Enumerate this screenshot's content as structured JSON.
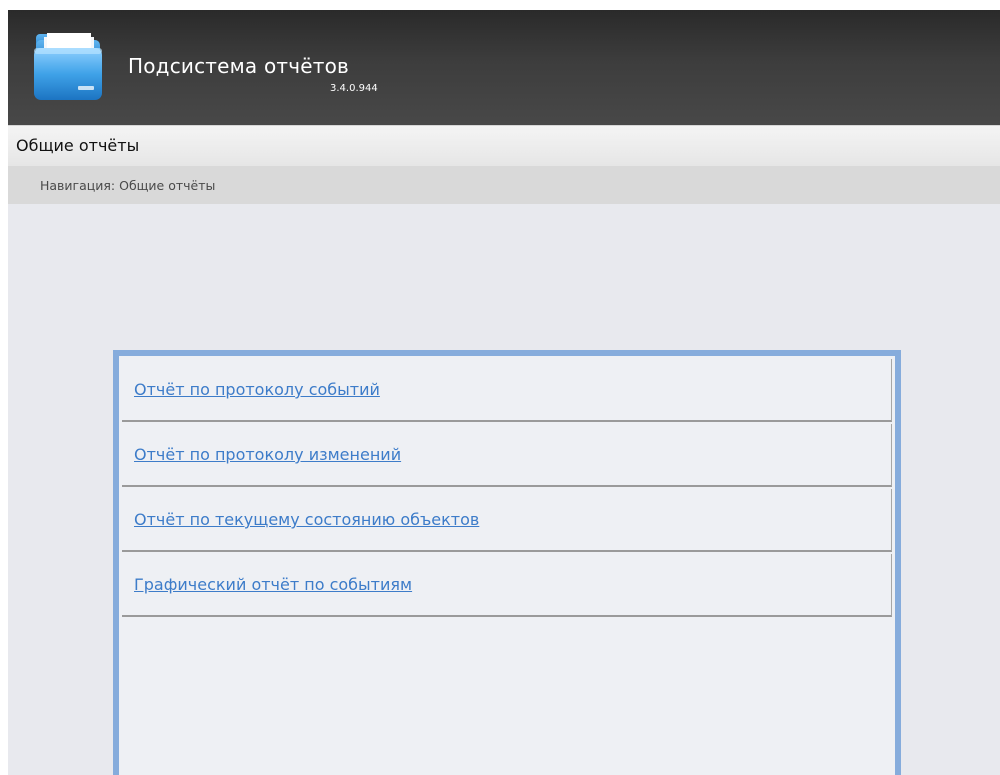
{
  "header": {
    "title": "Подсистема отчётов",
    "version": "3.4.0.944",
    "logo_icon": "folder-icon"
  },
  "section": {
    "title": "Общие отчёты"
  },
  "breadcrumb": {
    "text": "Навигация: Общие отчёты"
  },
  "reports": [
    {
      "label": "Отчёт по протоколу событий"
    },
    {
      "label": "Отчёт по протоколу изменений"
    },
    {
      "label": "Отчёт по текущему состоянию объектов"
    },
    {
      "label": "Графический отчёт по событиям"
    }
  ],
  "colors": {
    "header_dark": "#3d3d3d",
    "panel_border": "#86acdc",
    "link": "#3d7cc9",
    "background": "#e8e9ee"
  }
}
